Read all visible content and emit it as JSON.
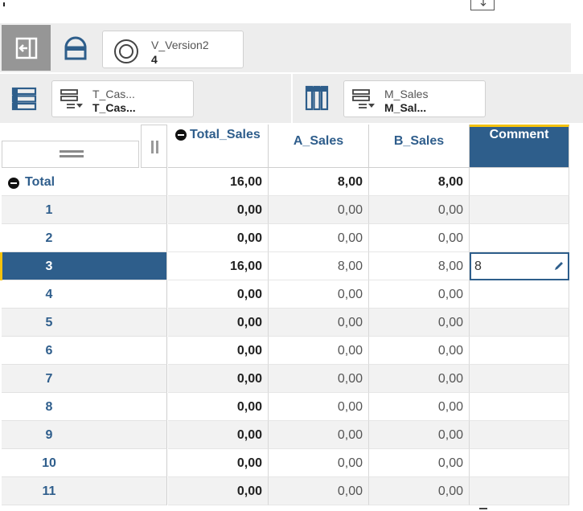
{
  "colors": {
    "accent": "#2e5e8b",
    "highlight": "#f4c20d",
    "toolbar_bg": "#ededed",
    "active_button": "#969696"
  },
  "toolbar": {
    "version": {
      "name": "V_Version2",
      "value": "4"
    }
  },
  "rows_dimension": {
    "name": "T_Cas...",
    "value": "T_Cas..."
  },
  "columns_dimension": {
    "name": "M_Sales",
    "value": "M_Sal..."
  },
  "columns": [
    "Total_Sales",
    "A_Sales",
    "B_Sales",
    "Comment"
  ],
  "rows": [
    {
      "label": "Total",
      "total_sales": "16,00",
      "a_sales": "8,00",
      "b_sales": "8,00",
      "comment": ""
    },
    {
      "label": "1",
      "total_sales": "0,00",
      "a_sales": "0,00",
      "b_sales": "0,00",
      "comment": ""
    },
    {
      "label": "2",
      "total_sales": "0,00",
      "a_sales": "0,00",
      "b_sales": "0,00",
      "comment": ""
    },
    {
      "label": "3",
      "total_sales": "16,00",
      "a_sales": "8,00",
      "b_sales": "8,00",
      "comment": "8"
    },
    {
      "label": "4",
      "total_sales": "0,00",
      "a_sales": "0,00",
      "b_sales": "0,00",
      "comment": ""
    },
    {
      "label": "5",
      "total_sales": "0,00",
      "a_sales": "0,00",
      "b_sales": "0,00",
      "comment": ""
    },
    {
      "label": "6",
      "total_sales": "0,00",
      "a_sales": "0,00",
      "b_sales": "0,00",
      "comment": ""
    },
    {
      "label": "7",
      "total_sales": "0,00",
      "a_sales": "0,00",
      "b_sales": "0,00",
      "comment": ""
    },
    {
      "label": "8",
      "total_sales": "0,00",
      "a_sales": "0,00",
      "b_sales": "0,00",
      "comment": ""
    },
    {
      "label": "9",
      "total_sales": "0,00",
      "a_sales": "0,00",
      "b_sales": "0,00",
      "comment": ""
    },
    {
      "label": "10",
      "total_sales": "0,00",
      "a_sales": "0,00",
      "b_sales": "0,00",
      "comment": ""
    },
    {
      "label": "11",
      "total_sales": "0,00",
      "a_sales": "0,00",
      "b_sales": "0,00",
      "comment": ""
    }
  ],
  "selected_row": "3"
}
